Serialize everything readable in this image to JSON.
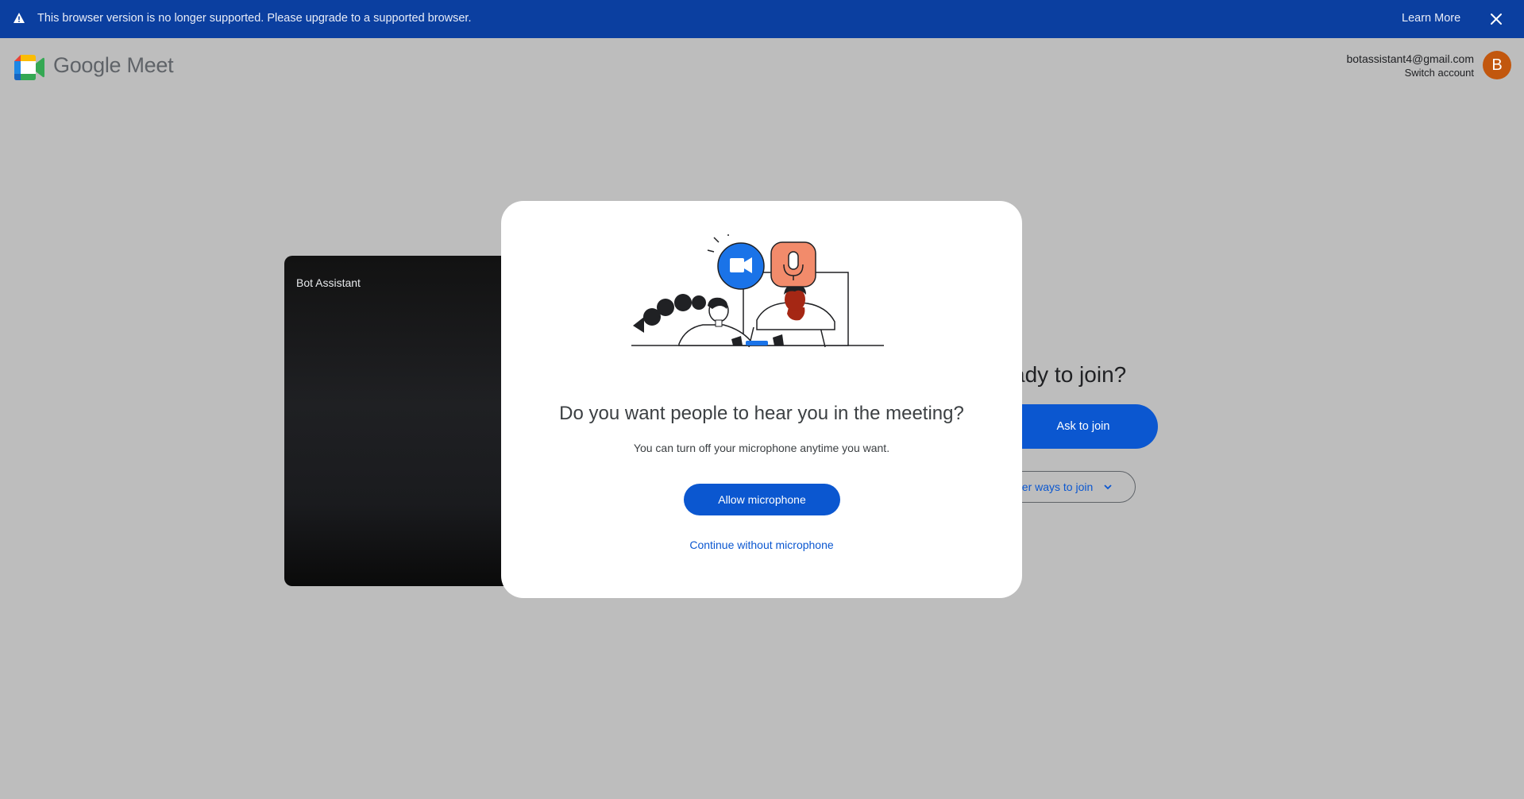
{
  "banner": {
    "message": "This browser version is no longer supported. Please upgrade to a supported browser.",
    "learn_more": "Learn More",
    "bg_color": "#0b3fa0"
  },
  "header": {
    "brand": "Google Meet",
    "account_email": "botassistant4@gmail.com",
    "switch_account": "Switch account",
    "avatar_initial": "B",
    "avatar_color": "#c2570e"
  },
  "preview": {
    "name": "Bot Assistant"
  },
  "join": {
    "title_partial": "ady to join?",
    "ask_button": "Ask to join",
    "other_ways_partial": "her ways to join"
  },
  "dialog": {
    "title": "Do you want people to hear you in the meeting?",
    "subtitle": "You can turn off your microphone anytime you want.",
    "allow_button": "Allow microphone",
    "continue_link": "Continue without microphone",
    "accent_color": "#0b57d0"
  }
}
